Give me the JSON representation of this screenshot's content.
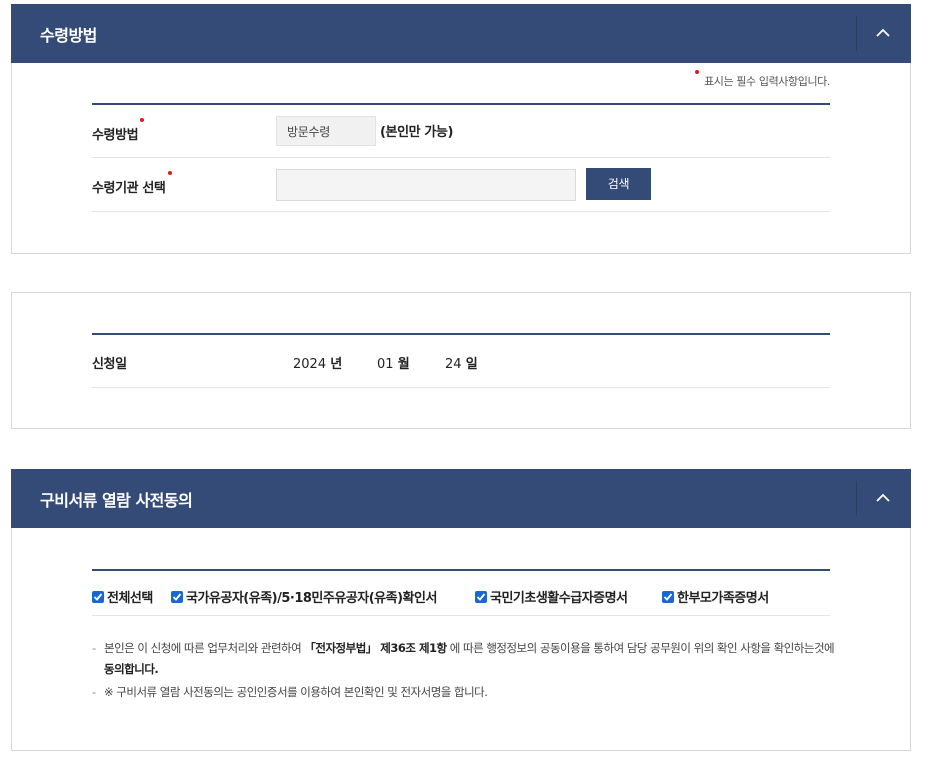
{
  "section1": {
    "title": "수령방법",
    "required_note": "표시는 필수 입력사항입니다.",
    "method_label": "수령방법",
    "method_value": "방문수령",
    "method_hint": "(본인만 가능)",
    "agency_label": "수령기관 선택",
    "agency_value": "",
    "search_button": "검색"
  },
  "section2": {
    "date_label": "신청일",
    "year": "2024",
    "year_unit": "년",
    "month": "01",
    "month_unit": "월",
    "day": "24",
    "day_unit": "일"
  },
  "section3": {
    "title": "구비서류 열람 사전동의",
    "checkboxes": [
      {
        "label": "전체선택",
        "checked": true
      },
      {
        "label": "국가유공자(유족)/5·18민주유공자(유족)확인서",
        "checked": true
      },
      {
        "label": "국민기초생활수급자증명서",
        "checked": true
      },
      {
        "label": "한부모가족증명서",
        "checked": true
      }
    ],
    "note1_part1": "본인은 이 신청에 따른 업무처리와 관련하여 ",
    "note1_bold1": "「전자정부법」 제36조 제1항",
    "note1_part2": " 에 따른 행정정보의 공동이용을 통하여 담당 공무원이 위의 확인 사항을 확인하는것에 ",
    "note1_bold2": "동의합니다.",
    "note2": "※ 구비서류 열람 사전동의는 공인인증서를 이용하여 본인확인 및 전자서명을 합니다."
  },
  "colors": {
    "header_bg": "#344a77",
    "required_dot": "#e0191b",
    "checkbox": "#1967d2"
  }
}
